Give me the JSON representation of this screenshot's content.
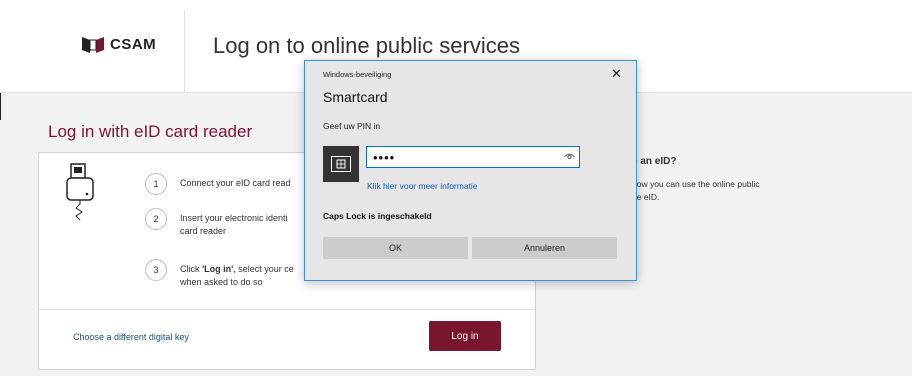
{
  "header": {
    "logo_text": "CSAM",
    "title": "Log on to online public services"
  },
  "main": {
    "section_title": "Log in with eID card reader",
    "steps": [
      {
        "number": "1",
        "text": "Connect your eID card read"
      },
      {
        "number": "2",
        "text_line1": "Insert your electronic identi",
        "text_line2": "card reader"
      },
      {
        "number": "3",
        "text_pre": "Click ",
        "text_bold": "'Log in'",
        "text_post": ", select your ce",
        "text_line2": "when asked to do so"
      }
    ],
    "alt_key_link": "Choose a different digital key",
    "login_button": "Log in"
  },
  "side": {
    "title": "e an eID?",
    "text_line1": "how you can use the online public",
    "text_line2": "he eID."
  },
  "dialog": {
    "caption": "Windows-beveiliging",
    "close_glyph": "✕",
    "heading": "Smartcard",
    "prompt": "Geef uw PIN in",
    "pin_value": "••••",
    "more_info_link": "Klik hier voor meer informatie",
    "caps_lock_warning": "Caps Lock is ingeschakeld",
    "ok_button": "OK",
    "cancel_button": "Annuleren"
  },
  "colors": {
    "brand": "#7a1530",
    "link": "#1f4f7a",
    "dialog_border": "#3f8fd6",
    "input_focus": "#0a6ccf"
  },
  "icons": [
    "csam-logo-icon",
    "card-reader-icon",
    "smartcard-icon",
    "reveal-password-icon",
    "close-icon"
  ]
}
